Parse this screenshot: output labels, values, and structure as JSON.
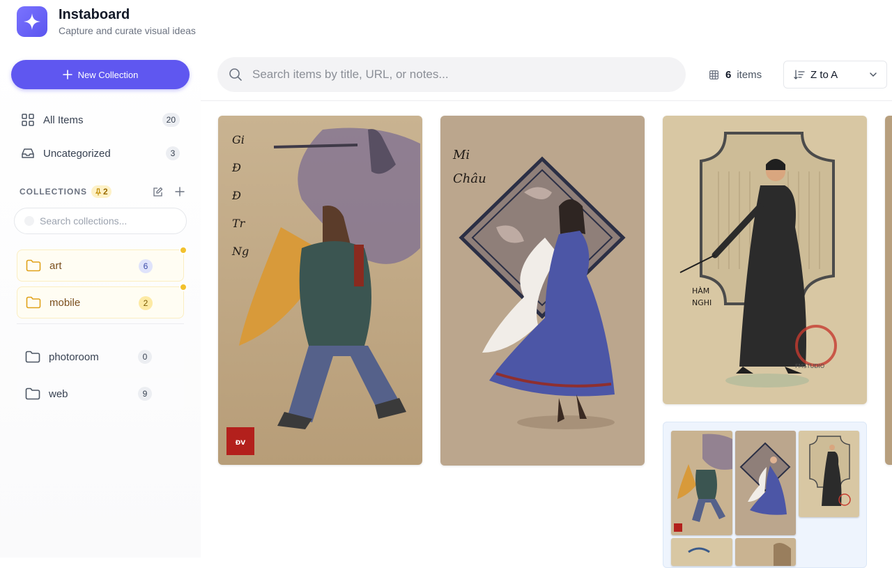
{
  "app": {
    "title": "Instaboard",
    "subtitle": "Capture and curate visual ideas",
    "logo_icon": "sparkle-icon",
    "accent_color": "#5f57f0"
  },
  "sidebar": {
    "new_collection_label": "New Collection",
    "nav": [
      {
        "label": "All Items",
        "count": "20",
        "icon": "grid-icon"
      },
      {
        "label": "Uncategorized",
        "count": "3",
        "icon": "inbox-icon"
      }
    ],
    "collections_title": "COLLECTIONS",
    "pinned_count": "2",
    "collections_search_placeholder": "Search collections...",
    "pinned_collections": [
      {
        "name": "art",
        "count": "6",
        "badge_color": "#dfe3fb"
      },
      {
        "name": "mobile",
        "count": "2",
        "badge_color": "#fdeaa4"
      }
    ],
    "collections": [
      {
        "name": "photoroom",
        "count": "0"
      },
      {
        "name": "web",
        "count": "9"
      }
    ]
  },
  "toolbar": {
    "search_placeholder": "Search items by title, URL, or notes...",
    "item_count": "6",
    "item_count_label": "items",
    "sort_value": "Z to A"
  },
  "cards": {
    "card1_caption": "Gián Định Đế - Trần Ngỗi",
    "card1_stamp": "ĐẠI VIỆT",
    "card2_caption": "Mi Châu",
    "card3_caption": "HÀM NGHI",
    "card3_watermark": "FMSTUDIO"
  }
}
